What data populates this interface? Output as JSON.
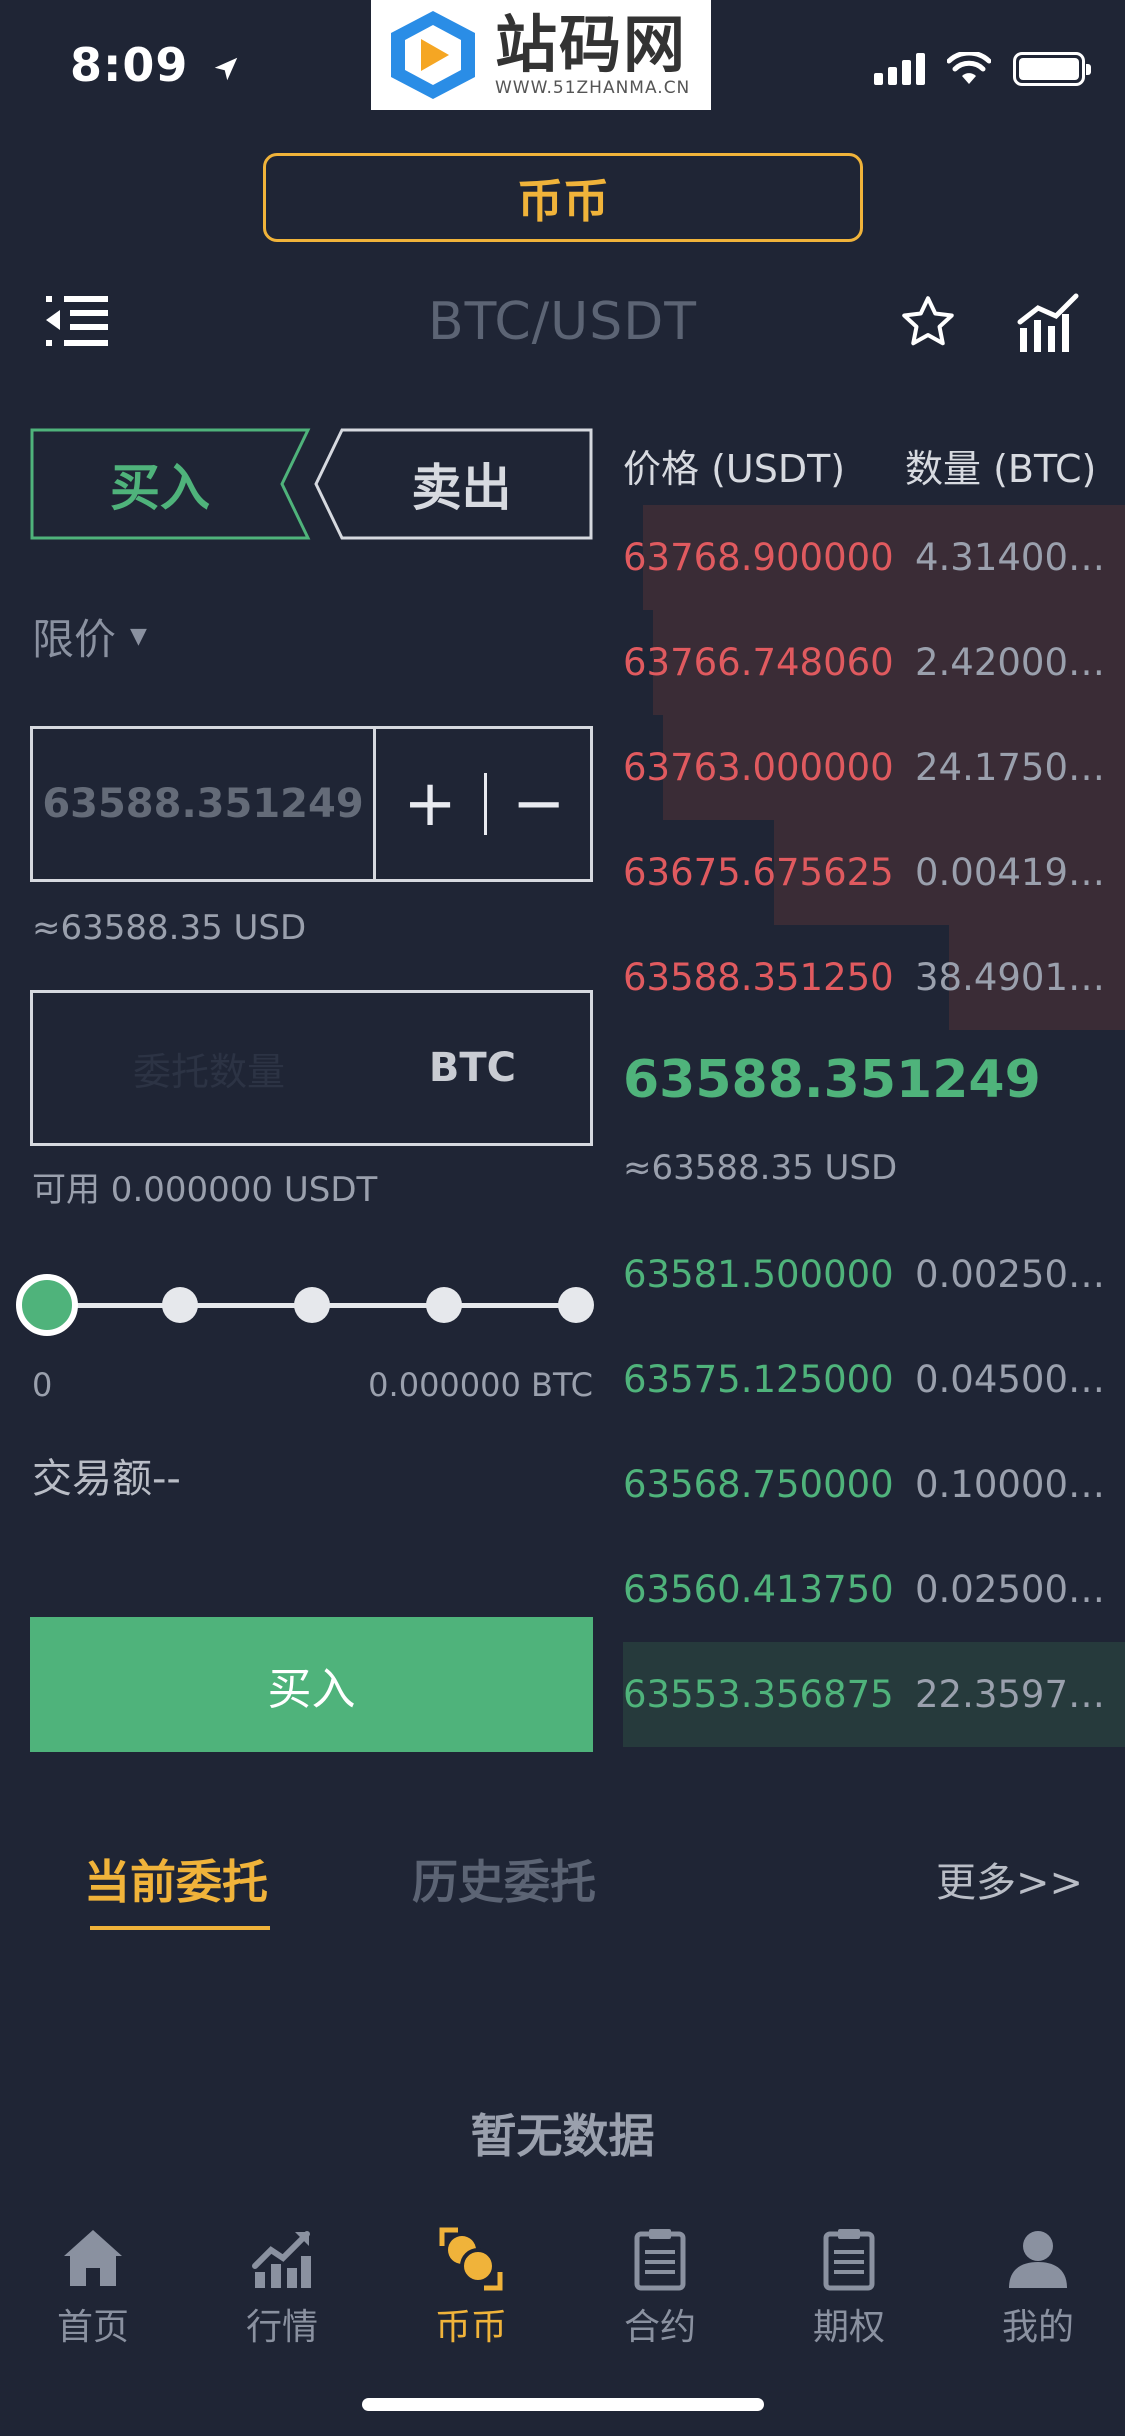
{
  "status_bar": {
    "time": "8:09"
  },
  "watermark": {
    "text": "站码网",
    "url": "WWW.51ZHANMA.CN"
  },
  "mode": {
    "label": "币币"
  },
  "header": {
    "pair": "BTC/USDT"
  },
  "trade_tabs": {
    "buy": "买入",
    "sell": "卖出",
    "active": "buy"
  },
  "order_type": {
    "label": "限价"
  },
  "price_input": {
    "value": "63588.351249",
    "plus": "+",
    "minus": "−"
  },
  "price_usd": "≈63588.35 USD",
  "amount_input": {
    "placeholder": "委托数量",
    "unit": "BTC"
  },
  "available": "可用 0.000000 USDT",
  "slider": {
    "min_label": "0",
    "max_label": "0.000000 BTC",
    "value_percent": 0
  },
  "trade_amount": "交易额--",
  "buy_button": "买入",
  "order_book": {
    "price_header": "价格 (USDT)",
    "qty_header": "数量 (BTC)",
    "asks": [
      {
        "price": "63768.900000",
        "qty": "4.31400…",
        "depth": 0.96
      },
      {
        "price": "63766.748060",
        "qty": "2.42000…",
        "depth": 0.94
      },
      {
        "price": "63763.000000",
        "qty": "24.1750…",
        "depth": 0.92
      },
      {
        "price": "63675.675625",
        "qty": "0.00419…",
        "depth": 0.7
      },
      {
        "price": "63588.351250",
        "qty": "38.4901…",
        "depth": 0.35
      }
    ],
    "last_price": "63588.351249",
    "last_usd": "≈63588.35 USD",
    "bids": [
      {
        "price": "63581.500000",
        "qty": "0.00250…",
        "depth": 0
      },
      {
        "price": "63575.125000",
        "qty": "0.04500…",
        "depth": 0
      },
      {
        "price": "63568.750000",
        "qty": "0.10000…",
        "depth": 0
      },
      {
        "price": "63560.413750",
        "qty": "0.02500…",
        "depth": 0
      },
      {
        "price": "63553.356875",
        "qty": "22.3597…",
        "depth": 1.0
      }
    ]
  },
  "orders": {
    "current_tab": "当前委托",
    "history_tab": "历史委托",
    "more": "更多>>",
    "empty": "暂无数据"
  },
  "bottom_nav": [
    {
      "label": "首页",
      "icon": "home-icon"
    },
    {
      "label": "行情",
      "icon": "market-chart-icon"
    },
    {
      "label": "币币",
      "icon": "coins-icon",
      "active": true
    },
    {
      "label": "合约",
      "icon": "contract-clipboard-icon"
    },
    {
      "label": "期权",
      "icon": "options-clipboard-icon"
    },
    {
      "label": "我的",
      "icon": "user-icon"
    }
  ],
  "colors": {
    "accent": "#f0b33a",
    "buy": "#4fb37b",
    "sell": "#e05a5f",
    "background": "#1f2535"
  }
}
